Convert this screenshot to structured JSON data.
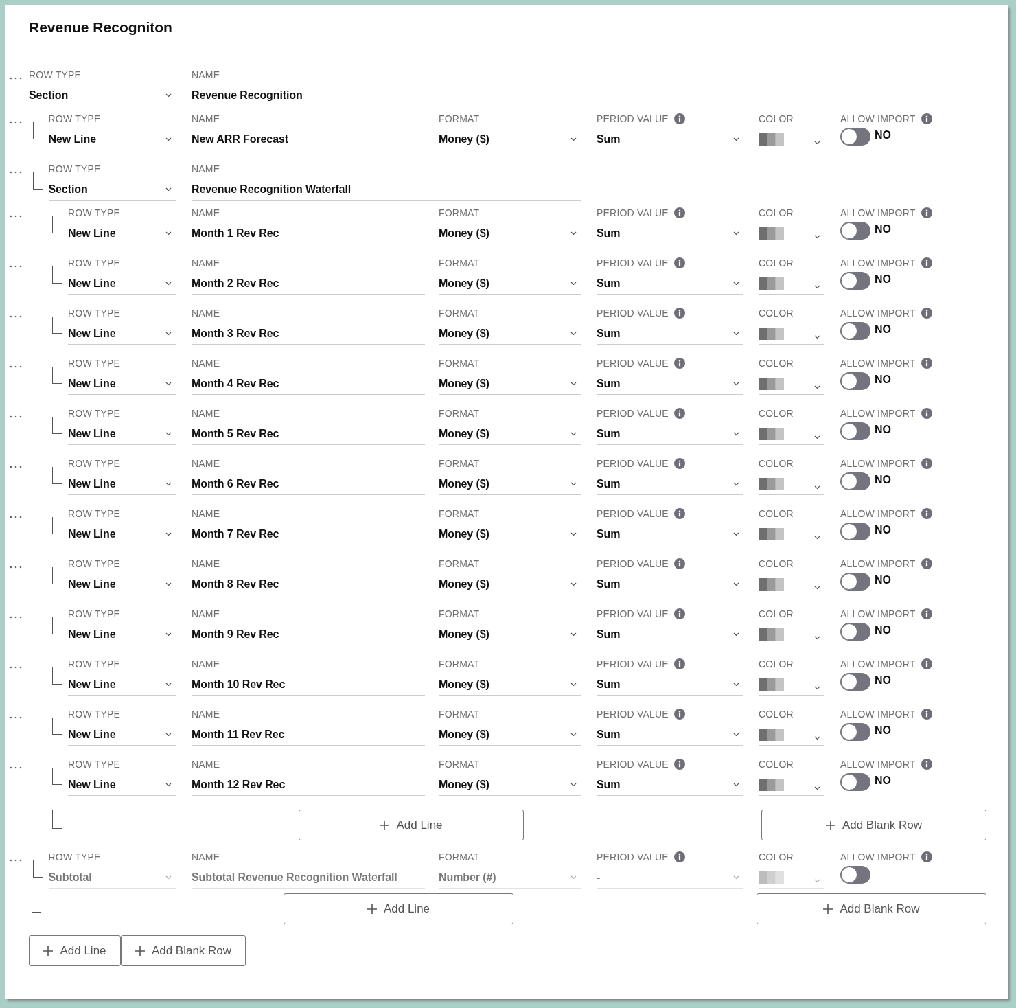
{
  "title": "Revenue Recogniton",
  "rows": [
    {
      "kind": "section",
      "disabled": false,
      "row_type": {
        "label": "ROW TYPE",
        "value": "Section"
      },
      "name": {
        "label": "NAME",
        "value": "Revenue Recognition"
      },
      "children": [
        {
          "kind": "line",
          "disabled": false,
          "row_type": {
            "label": "ROW TYPE",
            "value": "New Line"
          },
          "name": {
            "label": "NAME",
            "value": "New ARR Forecast"
          },
          "format": {
            "label": "FORMAT",
            "value": "Money ($)"
          },
          "period_value": {
            "label": "PERIOD VALUE",
            "value": "Sum"
          },
          "color": {
            "label": "COLOR"
          },
          "allow_import": {
            "label": "ALLOW IMPORT",
            "on": false,
            "value": "NO"
          }
        },
        {
          "kind": "section",
          "disabled": false,
          "row_type": {
            "label": "ROW TYPE",
            "value": "Section"
          },
          "name": {
            "label": "NAME",
            "value": "Revenue Recognition Waterfall"
          },
          "children": [
            {
              "kind": "line",
              "disabled": false,
              "row_type": {
                "label": "ROW TYPE",
                "value": "New Line"
              },
              "name": {
                "label": "NAME",
                "value": "Month 1 Rev Rec"
              },
              "format": {
                "label": "FORMAT",
                "value": "Money ($)"
              },
              "period_value": {
                "label": "PERIOD VALUE",
                "value": "Sum"
              },
              "color": {
                "label": "COLOR"
              },
              "allow_import": {
                "label": "ALLOW IMPORT",
                "on": false,
                "value": "NO"
              }
            },
            {
              "kind": "line",
              "disabled": false,
              "row_type": {
                "label": "ROW TYPE",
                "value": "New Line"
              },
              "name": {
                "label": "NAME",
                "value": "Month 2 Rev Rec"
              },
              "format": {
                "label": "FORMAT",
                "value": "Money ($)"
              },
              "period_value": {
                "label": "PERIOD VALUE",
                "value": "Sum"
              },
              "color": {
                "label": "COLOR"
              },
              "allow_import": {
                "label": "ALLOW IMPORT",
                "on": false,
                "value": "NO"
              }
            },
            {
              "kind": "line",
              "disabled": false,
              "row_type": {
                "label": "ROW TYPE",
                "value": "New Line"
              },
              "name": {
                "label": "NAME",
                "value": "Month 3 Rev Rec"
              },
              "format": {
                "label": "FORMAT",
                "value": "Money ($)"
              },
              "period_value": {
                "label": "PERIOD VALUE",
                "value": "Sum"
              },
              "color": {
                "label": "COLOR"
              },
              "allow_import": {
                "label": "ALLOW IMPORT",
                "on": false,
                "value": "NO"
              }
            },
            {
              "kind": "line",
              "disabled": false,
              "row_type": {
                "label": "ROW TYPE",
                "value": "New Line"
              },
              "name": {
                "label": "NAME",
                "value": "Month 4 Rev Rec"
              },
              "format": {
                "label": "FORMAT",
                "value": "Money ($)"
              },
              "period_value": {
                "label": "PERIOD VALUE",
                "value": "Sum"
              },
              "color": {
                "label": "COLOR"
              },
              "allow_import": {
                "label": "ALLOW IMPORT",
                "on": false,
                "value": "NO"
              }
            },
            {
              "kind": "line",
              "disabled": false,
              "row_type": {
                "label": "ROW TYPE",
                "value": "New Line"
              },
              "name": {
                "label": "NAME",
                "value": "Month 5 Rev Rec"
              },
              "format": {
                "label": "FORMAT",
                "value": "Money ($)"
              },
              "period_value": {
                "label": "PERIOD VALUE",
                "value": "Sum"
              },
              "color": {
                "label": "COLOR"
              },
              "allow_import": {
                "label": "ALLOW IMPORT",
                "on": false,
                "value": "NO"
              }
            },
            {
              "kind": "line",
              "disabled": false,
              "row_type": {
                "label": "ROW TYPE",
                "value": "New Line"
              },
              "name": {
                "label": "NAME",
                "value": "Month 6 Rev Rec"
              },
              "format": {
                "label": "FORMAT",
                "value": "Money ($)"
              },
              "period_value": {
                "label": "PERIOD VALUE",
                "value": "Sum"
              },
              "color": {
                "label": "COLOR"
              },
              "allow_import": {
                "label": "ALLOW IMPORT",
                "on": false,
                "value": "NO"
              }
            },
            {
              "kind": "line",
              "disabled": false,
              "row_type": {
                "label": "ROW TYPE",
                "value": "New Line"
              },
              "name": {
                "label": "NAME",
                "value": "Month 7 Rev Rec"
              },
              "format": {
                "label": "FORMAT",
                "value": "Money ($)"
              },
              "period_value": {
                "label": "PERIOD VALUE",
                "value": "Sum"
              },
              "color": {
                "label": "COLOR"
              },
              "allow_import": {
                "label": "ALLOW IMPORT",
                "on": false,
                "value": "NO"
              }
            },
            {
              "kind": "line",
              "disabled": false,
              "row_type": {
                "label": "ROW TYPE",
                "value": "New Line"
              },
              "name": {
                "label": "NAME",
                "value": "Month 8 Rev Rec"
              },
              "format": {
                "label": "FORMAT",
                "value": "Money ($)"
              },
              "period_value": {
                "label": "PERIOD VALUE",
                "value": "Sum"
              },
              "color": {
                "label": "COLOR"
              },
              "allow_import": {
                "label": "ALLOW IMPORT",
                "on": false,
                "value": "NO"
              }
            },
            {
              "kind": "line",
              "disabled": false,
              "row_type": {
                "label": "ROW TYPE",
                "value": "New Line"
              },
              "name": {
                "label": "NAME",
                "value": "Month 9 Rev Rec"
              },
              "format": {
                "label": "FORMAT",
                "value": "Money ($)"
              },
              "period_value": {
                "label": "PERIOD VALUE",
                "value": "Sum"
              },
              "color": {
                "label": "COLOR"
              },
              "allow_import": {
                "label": "ALLOW IMPORT",
                "on": false,
                "value": "NO"
              }
            },
            {
              "kind": "line",
              "disabled": false,
              "row_type": {
                "label": "ROW TYPE",
                "value": "New Line"
              },
              "name": {
                "label": "NAME",
                "value": "Month 10 Rev Rec"
              },
              "format": {
                "label": "FORMAT",
                "value": "Money ($)"
              },
              "period_value": {
                "label": "PERIOD VALUE",
                "value": "Sum"
              },
              "color": {
                "label": "COLOR"
              },
              "allow_import": {
                "label": "ALLOW IMPORT",
                "on": false,
                "value": "NO"
              }
            },
            {
              "kind": "line",
              "disabled": false,
              "row_type": {
                "label": "ROW TYPE",
                "value": "New Line"
              },
              "name": {
                "label": "NAME",
                "value": "Month 11 Rev Rec"
              },
              "format": {
                "label": "FORMAT",
                "value": "Money ($)"
              },
              "period_value": {
                "label": "PERIOD VALUE",
                "value": "Sum"
              },
              "color": {
                "label": "COLOR"
              },
              "allow_import": {
                "label": "ALLOW IMPORT",
                "on": false,
                "value": "NO"
              }
            },
            {
              "kind": "line",
              "disabled": false,
              "row_type": {
                "label": "ROW TYPE",
                "value": "New Line"
              },
              "name": {
                "label": "NAME",
                "value": "Month 12 Rev Rec"
              },
              "format": {
                "label": "FORMAT",
                "value": "Money ($)"
              },
              "period_value": {
                "label": "PERIOD VALUE",
                "value": "Sum"
              },
              "color": {
                "label": "COLOR"
              },
              "allow_import": {
                "label": "ALLOW IMPORT",
                "on": false,
                "value": "NO"
              }
            }
          ],
          "footer": {
            "add_line": "Add Line",
            "add_blank_row": "Add Blank Row"
          }
        },
        {
          "kind": "subtotal",
          "disabled": true,
          "row_type": {
            "label": "ROW TYPE",
            "value": "Subtotal"
          },
          "name": {
            "label": "NAME",
            "value": "Subtotal Revenue Recognition Waterfall"
          },
          "format": {
            "label": "FORMAT",
            "value": "Number (#)"
          },
          "period_value": {
            "label": "PERIOD VALUE",
            "value": "-"
          },
          "color": {
            "label": "COLOR"
          },
          "allow_import": {
            "label": "ALLOW IMPORT",
            "on": false
          }
        }
      ],
      "footer": {
        "add_line": "Add Line",
        "add_blank_row": "Add Blank Row"
      }
    }
  ],
  "actions": {
    "add_line": "Add Line",
    "add_blank_row": "Add Blank Row"
  }
}
